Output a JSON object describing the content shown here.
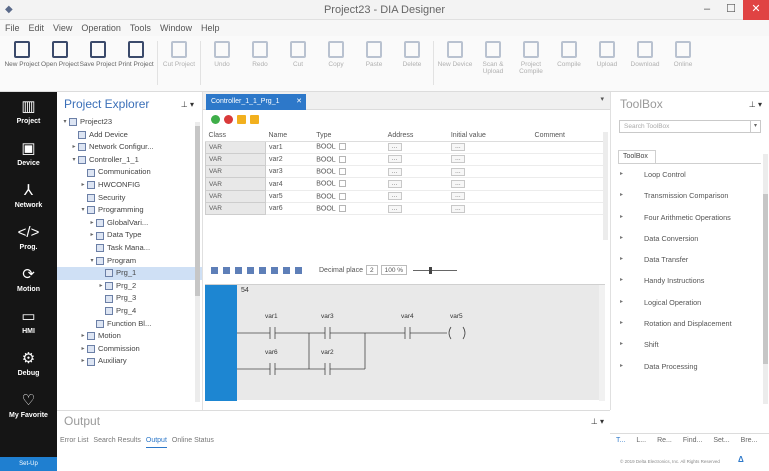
{
  "window": {
    "title": "Project23 - DIA Designer"
  },
  "menu": [
    "File",
    "Edit",
    "View",
    "Operation",
    "Tools",
    "Window",
    "Help"
  ],
  "ribbon": [
    {
      "label": "New Project",
      "enabled": true
    },
    {
      "label": "Open Project",
      "enabled": true
    },
    {
      "label": "Save Project",
      "enabled": true
    },
    {
      "label": "Print Project",
      "enabled": true
    },
    {
      "label": "Cut Project",
      "enabled": false
    },
    {
      "label": "Undo",
      "enabled": false
    },
    {
      "label": "Redo",
      "enabled": false
    },
    {
      "label": "Cut",
      "enabled": false
    },
    {
      "label": "Copy",
      "enabled": false
    },
    {
      "label": "Paste",
      "enabled": false
    },
    {
      "label": "Delete",
      "enabled": false
    },
    {
      "label": "New Device",
      "enabled": false
    },
    {
      "label": "Scan & Upload",
      "enabled": false
    },
    {
      "label": "Project Compile",
      "enabled": false
    },
    {
      "label": "Compile",
      "enabled": false
    },
    {
      "label": "Upload",
      "enabled": false
    },
    {
      "label": "Download",
      "enabled": false
    },
    {
      "label": "Online",
      "enabled": false
    }
  ],
  "nav": [
    {
      "label": "Project",
      "icon": "book-icon"
    },
    {
      "label": "Device",
      "icon": "device-icon"
    },
    {
      "label": "Network",
      "icon": "network-icon"
    },
    {
      "label": "Prog.",
      "icon": "code-icon"
    },
    {
      "label": "Motion",
      "icon": "motion-icon"
    },
    {
      "label": "HMI",
      "icon": "monitor-icon"
    },
    {
      "label": "Debug",
      "icon": "bug-icon"
    },
    {
      "label": "My Favorite",
      "icon": "heart-icon"
    }
  ],
  "nav_bottom": "Set-Up",
  "explorer": {
    "title": "Project Explorer",
    "tree": [
      {
        "label": "Project23",
        "indent": 0,
        "arrow": "▾"
      },
      {
        "label": "Add Device",
        "indent": 1,
        "arrow": ""
      },
      {
        "label": "Network Configur...",
        "indent": 1,
        "arrow": "▸"
      },
      {
        "label": "Controller_1_1",
        "indent": 1,
        "arrow": "▾"
      },
      {
        "label": "Communication",
        "indent": 2,
        "arrow": ""
      },
      {
        "label": "HWCONFIG",
        "indent": 2,
        "arrow": "▸"
      },
      {
        "label": "Security",
        "indent": 2,
        "arrow": ""
      },
      {
        "label": "Programming",
        "indent": 2,
        "arrow": "▾"
      },
      {
        "label": "GlobalVari...",
        "indent": 3,
        "arrow": "▸"
      },
      {
        "label": "Data Type",
        "indent": 3,
        "arrow": "▸"
      },
      {
        "label": "Task Mana...",
        "indent": 3,
        "arrow": ""
      },
      {
        "label": "Program",
        "indent": 3,
        "arrow": "▾"
      },
      {
        "label": "Prg_1",
        "indent": 4,
        "arrow": "",
        "selected": true
      },
      {
        "label": "Prg_2",
        "indent": 4,
        "arrow": "▸"
      },
      {
        "label": "Prg_3",
        "indent": 4,
        "arrow": ""
      },
      {
        "label": "Prg_4",
        "indent": 4,
        "arrow": ""
      },
      {
        "label": "Function Bl...",
        "indent": 3,
        "arrow": ""
      },
      {
        "label": "Motion",
        "indent": 2,
        "arrow": "▸"
      },
      {
        "label": "Commission",
        "indent": 2,
        "arrow": "▸"
      },
      {
        "label": "Auxiliary",
        "indent": 2,
        "arrow": "▸"
      }
    ]
  },
  "editor": {
    "tab": "Controller_1_1_Prg_1",
    "columns": [
      "Class",
      "Name",
      "Type",
      "Address",
      "Initial value",
      "Comment"
    ],
    "rows": [
      {
        "class": "VAR",
        "name": "var1",
        "type": "BOOL"
      },
      {
        "class": "VAR",
        "name": "var2",
        "type": "BOOL"
      },
      {
        "class": "VAR",
        "name": "var3",
        "type": "BOOL"
      },
      {
        "class": "VAR",
        "name": "var4",
        "type": "BOOL"
      },
      {
        "class": "VAR",
        "name": "var5",
        "type": "BOOL"
      },
      {
        "class": "VAR",
        "name": "var6",
        "type": "BOOL"
      }
    ],
    "decimal_label": "Decimal place",
    "decimal_value": "2",
    "zoom": "100 %",
    "rung_number": "54",
    "contacts": {
      "row1": [
        "var1",
        "var3",
        "var4"
      ],
      "coil": "var5",
      "row2": [
        "var6",
        "var2"
      ]
    }
  },
  "toolbox": {
    "title": "ToolBox",
    "search_placeholder": "Search ToolBox",
    "tab": "ToolBox",
    "items": [
      "Loop Control",
      "Transmission Comparison",
      "Four Arithmetic Operations",
      "Data Conversion",
      "Data Transfer",
      "Handy Instructions",
      "Logical Operation",
      "Rotation and Displacement",
      "Shift",
      "Data Processing"
    ]
  },
  "output": {
    "title": "Output",
    "tabs": [
      "Error List",
      "Search Results",
      "Output",
      "Online Status"
    ],
    "active_tab": "Output"
  },
  "right_tabs": [
    "T...",
    "L...",
    "Re...",
    "Find...",
    "Set...",
    "Bre..."
  ],
  "copyright": "© 2019 Delta Electronics, Inc. All Rights Reserved",
  "logo": "ΔNELTA"
}
